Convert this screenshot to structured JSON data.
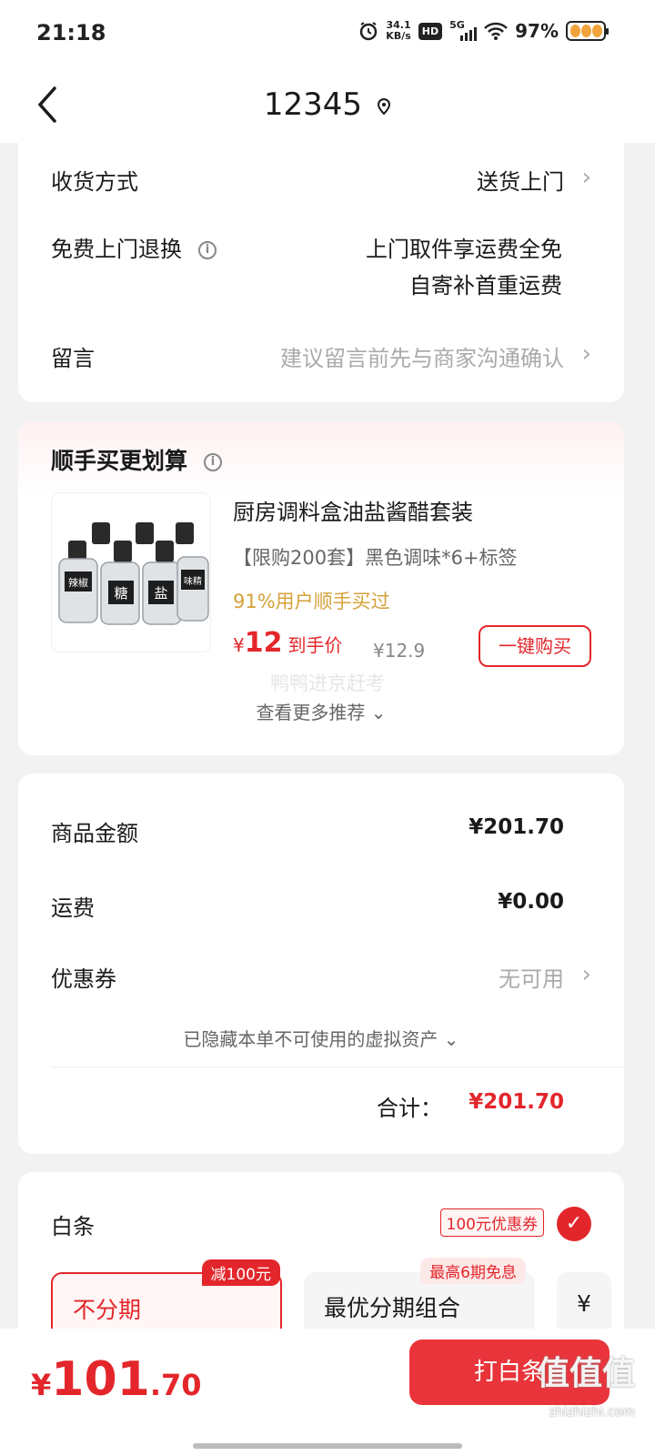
{
  "status_bar": {
    "time": "21:18",
    "network_speed_value": "34.1",
    "network_speed_unit": "KB/s",
    "hd_label": "HD",
    "network_type": "5G",
    "battery_percent": "97%"
  },
  "nav": {
    "title": "12345"
  },
  "delivery": {
    "method_label": "收货方式",
    "method_value": "送货上门",
    "return_label": "免费上门退换",
    "return_value_line1": "上门取件享运费全免",
    "return_value_line2": "自寄补首重运费",
    "message_label": "留言",
    "message_placeholder": "建议留言前先与商家沟通确认"
  },
  "recommend": {
    "title": "顺手买更划算",
    "product_name": "厨房调料盒油盐酱醋套装",
    "product_spec": "【限购200套】黑色调味*6+标签",
    "bought_text": "91%用户顺手买过",
    "price_symbol": "¥",
    "price": "12",
    "price_tag": "到手价",
    "original_price": "¥12.9",
    "buy_button": "一键购买",
    "more_label": "查看更多推荐",
    "watermark": "鸭鸭进京赶考",
    "jar_labels": [
      "辣椒",
      "糖",
      "盐",
      "味精"
    ]
  },
  "summary": {
    "goods_label": "商品金额",
    "goods_value": "¥201.70",
    "shipping_label": "运费",
    "shipping_value": "¥0.00",
    "coupon_label": "优惠券",
    "coupon_value": "无可用",
    "hidden_assets": "已隐藏本单不可使用的虚拟资产",
    "total_label": "合计：",
    "total_value": "¥201.70"
  },
  "payment": {
    "method_label": "白条",
    "coupon_badge": "100元优惠券",
    "option1_label": "不分期",
    "option1_badge": "减100元",
    "option2_label": "最优分期组合",
    "option2_badge": "最高6期免息",
    "option3_label": "¥"
  },
  "bottom": {
    "price_symbol": "¥",
    "price_int": "101",
    "price_dec": ".70",
    "pay_button": "打白条",
    "site_watermark": "值值值",
    "site_url": "zhizhizhi.com"
  },
  "colors": {
    "accent": "#e3262b",
    "gold": "#d4a23a"
  }
}
